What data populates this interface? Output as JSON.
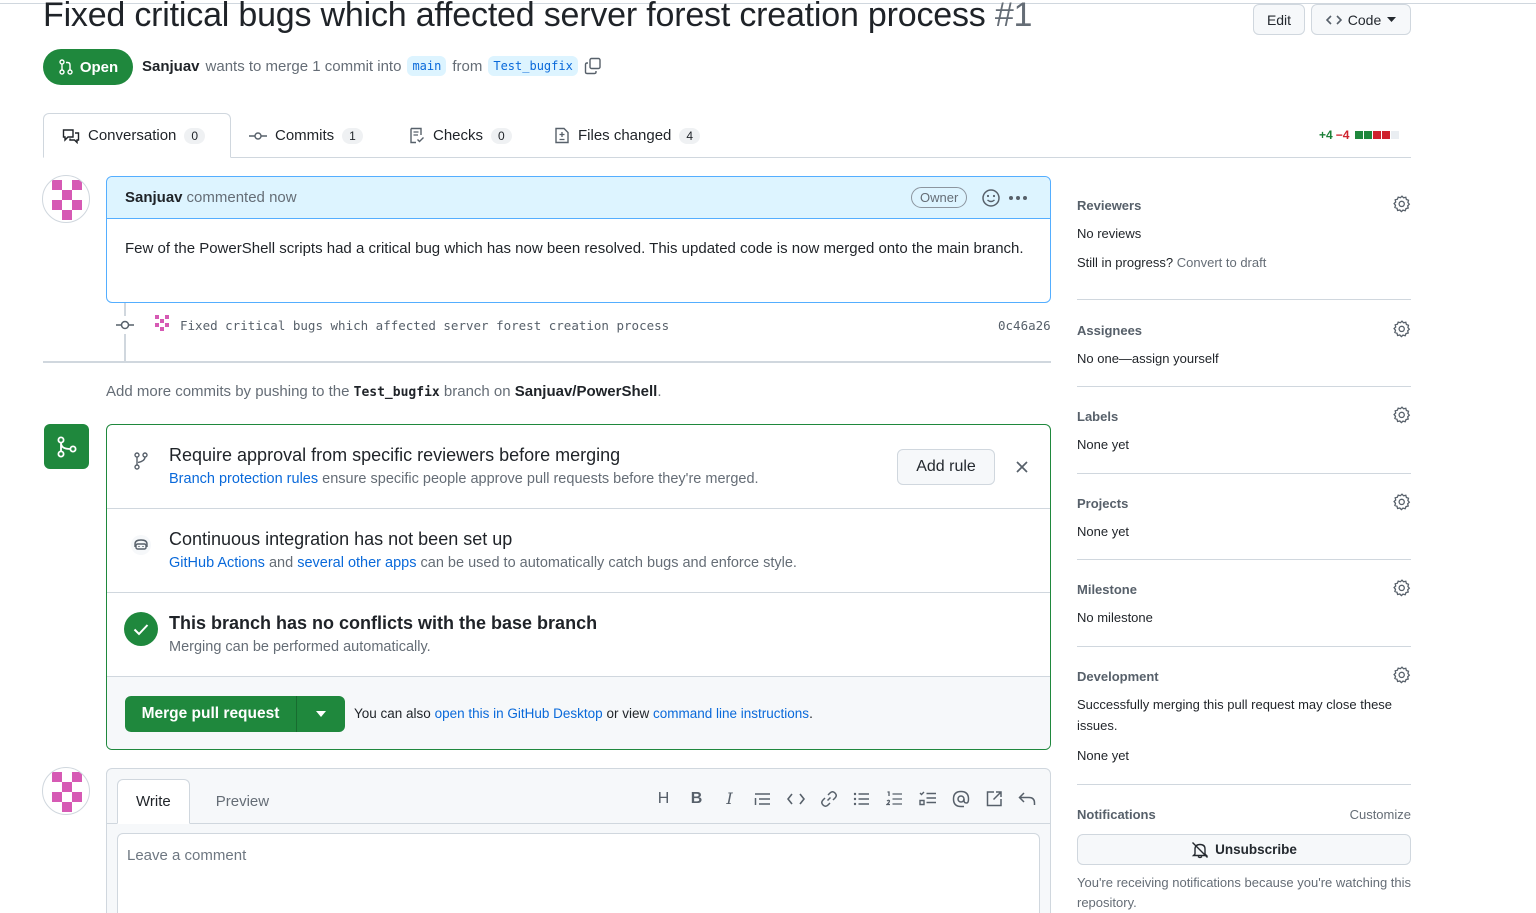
{
  "pr": {
    "title": "Fixed critical bugs which affected server forest creation process",
    "number": "#1",
    "state": "Open",
    "author": "Sanjuav",
    "merge_text": "wants to merge 1 commit into",
    "base_branch": "main",
    "from_text": "from",
    "head_branch": "Test_bugfix"
  },
  "header_buttons": {
    "edit": "Edit",
    "code": "Code"
  },
  "tabs": [
    {
      "label": "Conversation",
      "count": "0"
    },
    {
      "label": "Commits",
      "count": "1"
    },
    {
      "label": "Checks",
      "count": "0"
    },
    {
      "label": "Files changed",
      "count": "4"
    }
  ],
  "diffstat": {
    "additions": "+4",
    "deletions": "−4"
  },
  "comment": {
    "author": "Sanjuav",
    "time": "commented now",
    "badge": "Owner",
    "body": "Few of the PowerShell scripts had a critical bug which has now been resolved. This updated code is now merged onto the main branch."
  },
  "commit": {
    "message": "Fixed critical bugs which affected server forest creation process",
    "sha": "0c46a26"
  },
  "push_note": {
    "prefix": "Add more commits by pushing to the",
    "branch": "Test_bugfix",
    "middle": "branch on",
    "repo": "Sanjuav/PowerShell",
    "suffix": "."
  },
  "merge_box": {
    "rule_title": "Require approval from specific reviewers before merging",
    "rule_link": "Branch protection rules",
    "rule_sub": "ensure specific people approve pull requests before they're merged.",
    "add_rule": "Add rule",
    "ci_title": "Continuous integration has not been set up",
    "ci_link1": "GitHub Actions",
    "ci_and": "and",
    "ci_link2": "several other apps",
    "ci_sub": "can be used to automatically catch bugs and enforce style.",
    "conflict_title": "This branch has no conflicts with the base branch",
    "conflict_sub": "Merging can be performed automatically.",
    "merge_button": "Merge pull request",
    "footer_prefix": "You can also",
    "footer_link1": "open this in GitHub Desktop",
    "footer_mid": "or view",
    "footer_link2": "command line instructions",
    "footer_suffix": "."
  },
  "composer": {
    "write_tab": "Write",
    "preview_tab": "Preview",
    "placeholder": "Leave a comment"
  },
  "sidebar": {
    "reviewers": {
      "title": "Reviewers",
      "value": "No reviews",
      "draft_prefix": "Still in progress?",
      "draft_link": "Convert to draft"
    },
    "assignees": {
      "title": "Assignees",
      "value": "No one—assign yourself"
    },
    "labels": {
      "title": "Labels",
      "value": "None yet"
    },
    "projects": {
      "title": "Projects",
      "value": "None yet"
    },
    "milestone": {
      "title": "Milestone",
      "value": "No milestone"
    },
    "development": {
      "title": "Development",
      "desc": "Successfully merging this pull request may close these issues.",
      "value": "None yet"
    },
    "notifications": {
      "title": "Notifications",
      "customize": "Customize",
      "button": "Unsubscribe",
      "desc": "You're receiving notifications because you're watching this repository."
    }
  },
  "colors": {
    "green": "#1f883d",
    "blue": "#0969da",
    "accent_bg": "#ddf4ff",
    "avatar_pink": "#d65ab4"
  }
}
